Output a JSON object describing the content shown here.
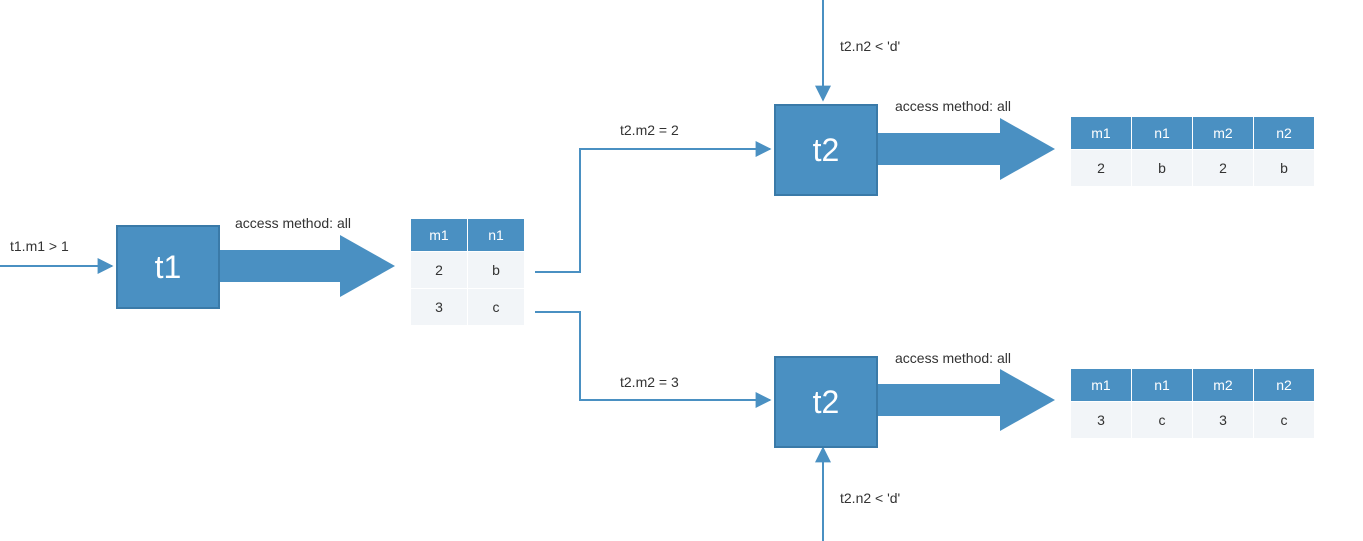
{
  "colors": {
    "primary": "#4a90c2",
    "primaryBorder": "#3a7aa8",
    "cellBg": "#f2f5f8",
    "text": "#333333"
  },
  "nodes": {
    "t1": {
      "label": "t1"
    },
    "t2top": {
      "label": "t2"
    },
    "t2bot": {
      "label": "t2"
    }
  },
  "labels": {
    "t1_filter": "t1.m1 > 1",
    "t1_method": "access method: all",
    "t2top_filterH": "t2.m2 = 2",
    "t2top_filterV": "t2.n2 < 'd'",
    "t2top_method": "access method: all",
    "t2bot_filterH": "t2.m2 = 3",
    "t2bot_filterV": "t2.n2 < 'd'",
    "t2bot_method": "access method: all"
  },
  "tables": {
    "t1out": {
      "headers": [
        "m1",
        "n1"
      ],
      "rows": [
        [
          "2",
          "b"
        ],
        [
          "3",
          "c"
        ]
      ]
    },
    "t2top_out": {
      "headers": [
        "m1",
        "n1",
        "m2",
        "n2"
      ],
      "rows": [
        [
          "2",
          "b",
          "2",
          "b"
        ]
      ]
    },
    "t2bot_out": {
      "headers": [
        "m1",
        "n1",
        "m2",
        "n2"
      ],
      "rows": [
        [
          "3",
          "c",
          "3",
          "c"
        ]
      ]
    }
  }
}
